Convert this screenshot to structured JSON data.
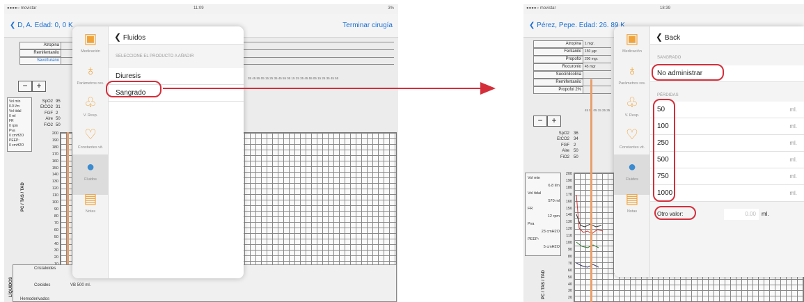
{
  "left": {
    "status": {
      "carrier": "●●●●○ movistar",
      "time": "11:09",
      "battery": "3%"
    },
    "nav": {
      "back": "D, A. Edad: 0, 0 K",
      "right": "Terminar cirugía"
    },
    "drugs": [
      "Atropina",
      "Remifentanilo",
      "Sevoflurano"
    ],
    "vitals_box": [
      "Vol min",
      "0.0 l/m",
      "Vol tidal",
      "0 ml",
      "FR",
      "0 rpm",
      "Pva",
      "0 cmH2O",
      "PEEP:",
      "0 cmH2O"
    ],
    "gas_rows": [
      "SpO2",
      "EtCO2",
      "FGF",
      "Aire",
      "FiO2"
    ],
    "gas_values": [
      "95",
      "31",
      "2",
      "50",
      "50"
    ],
    "axis": [
      "200",
      "190",
      "180",
      "170",
      "160",
      "150",
      "140",
      "130",
      "120",
      "110",
      "100",
      "90",
      "80",
      "70",
      "60",
      "50",
      "40",
      "30",
      "20",
      "10",
      "0"
    ],
    "axis_title": "PC / TAS / TAD",
    "time_labels": "35 45 55 05 15 25 35 45 55 05 15 25 35 45 55 05 15 25 35 45 55",
    "fluids_section": [
      "Cristaloides",
      "Coloides",
      "Hemoderivados"
    ],
    "coloides_value": "VB 500 ml.",
    "fluids_vertical": "LÍQUIDOS",
    "sidebar": [
      "Medicación",
      "Parámetros res.",
      "V. Resp.",
      "Constantes vit.",
      "Fluidos",
      "Notas"
    ],
    "panel_title": "Fluidos",
    "section": "SELECCIONE EL PRODUCTO A AÑADIR",
    "items": [
      "Diuresis",
      "Sangrado"
    ]
  },
  "right": {
    "status": {
      "carrier": "●●●●○ movistar",
      "time": "18:39"
    },
    "nav": {
      "back": "Pérez, Pepe. Edad: 26. 89 K"
    },
    "drugs": [
      "Atropina",
      "Fentanilo",
      "Propofol",
      "Rocuronio",
      "Succinilcolina",
      "Remifentanilo",
      "Propofol 2%"
    ],
    "drug_doses": [
      "1 mgr.",
      "150 µgr.",
      "200 mgr.",
      "45 mgr",
      "",
      "",
      ""
    ],
    "gas_rows": [
      "SpO2",
      "EtCO2",
      "FGF",
      "Aire",
      "FiO2"
    ],
    "gas_values": [
      "36",
      "34",
      "2",
      "50",
      "50"
    ],
    "vitals_box": [
      "Vol min",
      "6.8 l/m",
      "Vol tidal",
      "570 ml",
      "FR",
      "12 rpm",
      "Pva",
      "23 cmH2O",
      "PEEP:",
      "5 cmH2O"
    ],
    "axis": [
      "200",
      "190",
      "180",
      "170",
      "160",
      "150",
      "140",
      "130",
      "120",
      "110",
      "100",
      "90",
      "80",
      "70",
      "60",
      "50",
      "40",
      "30",
      "20",
      "10"
    ],
    "axis_title": "PC / TAS / TAD",
    "time_labels": "45 55 05 15 25 35",
    "sidebar": [
      "Medicación",
      "Parámetros res.",
      "V. Resp.",
      "Constantes vit.",
      "Fluidos",
      "Notas"
    ],
    "panel_title": "Back",
    "section1": "SANGRADO",
    "no_admin": "No administrar",
    "section2": "PÉRDIDAS",
    "amounts": [
      "50",
      "100",
      "250",
      "500",
      "750",
      "1000"
    ],
    "unit": "ml.",
    "otro_label": "Otro valor:",
    "otro_placeholder": "0.00",
    "otro_unit": "ml."
  },
  "colors": {
    "accent": "#1a6fd6",
    "highlight": "#d42e3a",
    "sidebar_icon": "#f0a33a",
    "active_icon": "#3a8bd0"
  }
}
